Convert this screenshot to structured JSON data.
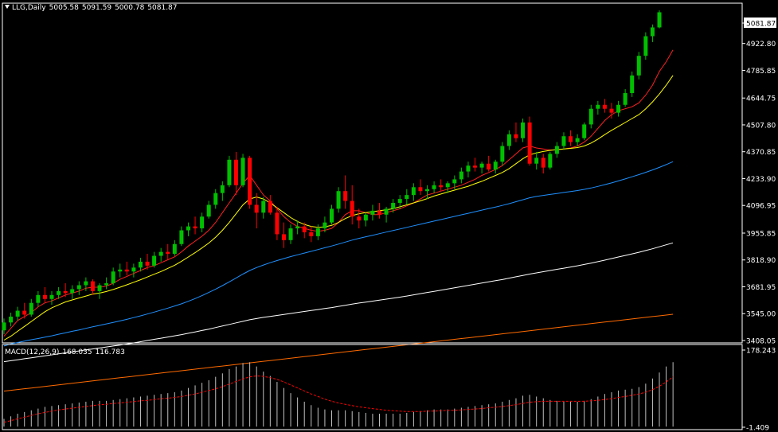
{
  "header": {
    "symbol": "LLG,Daily",
    "open": "5005.58",
    "high": "5091.59",
    "low": "5000.78",
    "close": "5081.87"
  },
  "macd_header": {
    "name": "MACD(12,26,9)",
    "macd": "168.035",
    "signal": "116.783"
  },
  "colors": {
    "background": "#000000",
    "frame": "#ffffff",
    "bull": "#00c000",
    "bear": "#ff0000",
    "ma_red": "#ff2020",
    "ma_yellow": "#ffff00",
    "ma_blue": "#1e90ff",
    "ma_white": "#ffffff",
    "ma_orange": "#ff6a00",
    "signal": "#ff0000"
  },
  "chart_data": {
    "type": "candlestick",
    "ylim": [
      3408.05,
      5096.0
    ],
    "y_ticks": [
      "5081.87",
      "4922.80",
      "4785.85",
      "4644.75",
      "4507.80",
      "4370.85",
      "4233.90",
      "4096.95",
      "3955.85",
      "3818.90",
      "3681.95",
      "3545.00",
      "3408.05"
    ],
    "current_price_label": "5081.87",
    "candles": [
      [
        3460,
        3520,
        3440,
        3500
      ],
      [
        3500,
        3550,
        3480,
        3530
      ],
      [
        3530,
        3580,
        3510,
        3560
      ],
      [
        3560,
        3600,
        3520,
        3540
      ],
      [
        3540,
        3620,
        3530,
        3600
      ],
      [
        3600,
        3660,
        3580,
        3640
      ],
      [
        3640,
        3680,
        3600,
        3620
      ],
      [
        3620,
        3660,
        3590,
        3640
      ],
      [
        3640,
        3680,
        3620,
        3660
      ],
      [
        3660,
        3700,
        3630,
        3650
      ],
      [
        3650,
        3690,
        3620,
        3670
      ],
      [
        3670,
        3710,
        3640,
        3690
      ],
      [
        3690,
        3730,
        3660,
        3710
      ],
      [
        3710,
        3720,
        3640,
        3660
      ],
      [
        3660,
        3700,
        3620,
        3690
      ],
      [
        3690,
        3730,
        3670,
        3700
      ],
      [
        3700,
        3780,
        3690,
        3760
      ],
      [
        3760,
        3800,
        3730,
        3770
      ],
      [
        3770,
        3810,
        3740,
        3760
      ],
      [
        3760,
        3800,
        3730,
        3780
      ],
      [
        3780,
        3830,
        3760,
        3810
      ],
      [
        3810,
        3850,
        3770,
        3790
      ],
      [
        3790,
        3860,
        3780,
        3840
      ],
      [
        3840,
        3880,
        3810,
        3860
      ],
      [
        3860,
        3900,
        3820,
        3850
      ],
      [
        3850,
        3920,
        3840,
        3900
      ],
      [
        3900,
        3990,
        3890,
        3970
      ],
      [
        3970,
        4010,
        3940,
        3990
      ],
      [
        3990,
        4040,
        3950,
        3980
      ],
      [
        3980,
        4060,
        3960,
        4040
      ],
      [
        4040,
        4120,
        4030,
        4100
      ],
      [
        4100,
        4180,
        4080,
        4160
      ],
      [
        4160,
        4220,
        4120,
        4200
      ],
      [
        4200,
        4350,
        4190,
        4330
      ],
      [
        4330,
        4370,
        4150,
        4200
      ],
      [
        4200,
        4360,
        4190,
        4340
      ],
      [
        4340,
        4350,
        4080,
        4100
      ],
      [
        4100,
        4160,
        3980,
        4060
      ],
      [
        4060,
        4140,
        4030,
        4120
      ],
      [
        4120,
        4150,
        4050,
        4060
      ],
      [
        4060,
        4090,
        3920,
        3950
      ],
      [
        3950,
        4010,
        3880,
        3920
      ],
      [
        3920,
        4000,
        3900,
        3980
      ],
      [
        3980,
        4020,
        3950,
        3990
      ],
      [
        3990,
        4010,
        3930,
        3960
      ],
      [
        3960,
        3990,
        3910,
        3940
      ],
      [
        3940,
        4000,
        3920,
        3980
      ],
      [
        3980,
        4040,
        3960,
        4010
      ],
      [
        4010,
        4100,
        4000,
        4080
      ],
      [
        4080,
        4190,
        4060,
        4170
      ],
      [
        4170,
        4250,
        4080,
        4120
      ],
      [
        4120,
        4200,
        4000,
        4040
      ],
      [
        4040,
        4080,
        3980,
        4020
      ],
      [
        4020,
        4060,
        3990,
        4050
      ],
      [
        4050,
        4100,
        4020,
        4070
      ],
      [
        4070,
        4110,
        4030,
        4050
      ],
      [
        4050,
        4090,
        4010,
        4080
      ],
      [
        4080,
        4130,
        4060,
        4110
      ],
      [
        4110,
        4150,
        4080,
        4130
      ],
      [
        4130,
        4180,
        4100,
        4150
      ],
      [
        4150,
        4210,
        4120,
        4190
      ],
      [
        4190,
        4230,
        4150,
        4170
      ],
      [
        4170,
        4200,
        4130,
        4180
      ],
      [
        4180,
        4220,
        4160,
        4200
      ],
      [
        4200,
        4230,
        4170,
        4190
      ],
      [
        4190,
        4220,
        4160,
        4210
      ],
      [
        4210,
        4250,
        4180,
        4230
      ],
      [
        4230,
        4290,
        4210,
        4270
      ],
      [
        4270,
        4320,
        4240,
        4300
      ],
      [
        4300,
        4340,
        4270,
        4290
      ],
      [
        4290,
        4320,
        4260,
        4310
      ],
      [
        4310,
        4350,
        4270,
        4280
      ],
      [
        4280,
        4330,
        4260,
        4320
      ],
      [
        4320,
        4420,
        4300,
        4400
      ],
      [
        4400,
        4480,
        4380,
        4460
      ],
      [
        4460,
        4520,
        4420,
        4440
      ],
      [
        4440,
        4540,
        4420,
        4520
      ],
      [
        4520,
        4550,
        4300,
        4310
      ],
      [
        4310,
        4370,
        4280,
        4340
      ],
      [
        4340,
        4360,
        4260,
        4290
      ],
      [
        4290,
        4370,
        4280,
        4360
      ],
      [
        4360,
        4420,
        4340,
        4400
      ],
      [
        4400,
        4470,
        4380,
        4450
      ],
      [
        4450,
        4480,
        4400,
        4420
      ],
      [
        4420,
        4460,
        4400,
        4440
      ],
      [
        4440,
        4520,
        4430,
        4510
      ],
      [
        4510,
        4610,
        4490,
        4590
      ],
      [
        4590,
        4630,
        4560,
        4610
      ],
      [
        4610,
        4640,
        4570,
        4590
      ],
      [
        4590,
        4620,
        4540,
        4570
      ],
      [
        4570,
        4630,
        4550,
        4610
      ],
      [
        4610,
        4690,
        4600,
        4670
      ],
      [
        4670,
        4780,
        4650,
        4760
      ],
      [
        4760,
        4880,
        4740,
        4860
      ],
      [
        4860,
        4980,
        4840,
        4960
      ],
      [
        4960,
        5020,
        4930,
        5005
      ],
      [
        5005,
        5092,
        5000,
        5082
      ]
    ],
    "moving_averages": [
      {
        "color": "ma_red",
        "values": [
          3430,
          3470,
          3510,
          3530,
          3550,
          3580,
          3600,
          3610,
          3625,
          3640,
          3650,
          3660,
          3675,
          3680,
          3680,
          3685,
          3700,
          3720,
          3735,
          3750,
          3765,
          3780,
          3790,
          3805,
          3820,
          3835,
          3860,
          3890,
          3915,
          3940,
          3970,
          4010,
          4060,
          4110,
          4160,
          4210,
          4250,
          4200,
          4150,
          4120,
          4080,
          4040,
          4010,
          3990,
          3980,
          3970,
          3965,
          3970,
          3980,
          4010,
          4050,
          4070,
          4070,
          4060,
          4050,
          4050,
          4060,
          4070,
          4080,
          4095,
          4110,
          4130,
          4150,
          4160,
          4170,
          4180,
          4190,
          4200,
          4215,
          4230,
          4250,
          4265,
          4280,
          4300,
          4330,
          4360,
          4390,
          4400,
          4390,
          4385,
          4380,
          4380,
          4385,
          4390,
          4400,
          4420,
          4450,
          4490,
          4530,
          4560,
          4580,
          4590,
          4600,
          4620,
          4660,
          4710,
          4780,
          4830,
          4890
        ]
      },
      {
        "color": "ma_yellow",
        "values": [
          3410,
          3430,
          3455,
          3480,
          3505,
          3530,
          3555,
          3575,
          3590,
          3605,
          3615,
          3625,
          3635,
          3645,
          3650,
          3658,
          3668,
          3680,
          3692,
          3705,
          3718,
          3732,
          3746,
          3760,
          3776,
          3792,
          3812,
          3834,
          3856,
          3880,
          3905,
          3935,
          3970,
          4010,
          4055,
          4100,
          4130,
          4140,
          4130,
          4110,
          4085,
          4060,
          4035,
          4015,
          4000,
          3990,
          3985,
          3988,
          3995,
          4010,
          4030,
          4045,
          4055,
          4060,
          4065,
          4070,
          4075,
          4080,
          4090,
          4100,
          4110,
          4120,
          4132,
          4145,
          4155,
          4165,
          4175,
          4185,
          4195,
          4208,
          4220,
          4235,
          4250,
          4265,
          4285,
          4310,
          4335,
          4355,
          4365,
          4372,
          4378,
          4382,
          4385,
          4388,
          4392,
          4400,
          4415,
          4435,
          4458,
          4480,
          4500,
          4520,
          4540,
          4560,
          4590,
          4625,
          4665,
          4710,
          4760
        ]
      },
      {
        "color": "ma_blue",
        "values": [
          3380,
          3390,
          3398,
          3405,
          3412,
          3418,
          3425,
          3432,
          3440,
          3447,
          3455,
          3462,
          3470,
          3478,
          3485,
          3493,
          3500,
          3508,
          3516,
          3525,
          3534,
          3543,
          3553,
          3563,
          3573,
          3584,
          3595,
          3608,
          3622,
          3637,
          3653,
          3670,
          3688,
          3707,
          3727,
          3747,
          3765,
          3780,
          3793,
          3805,
          3816,
          3826,
          3836,
          3845,
          3854,
          3863,
          3872,
          3881,
          3890,
          3900,
          3910,
          3920,
          3929,
          3937,
          3945,
          3953,
          3961,
          3969,
          3977,
          3985,
          3993,
          4001,
          4009,
          4017,
          4025,
          4033,
          4041,
          4049,
          4057,
          4065,
          4073,
          4081,
          4089,
          4097,
          4106,
          4116,
          4126,
          4136,
          4143,
          4148,
          4153,
          4158,
          4163,
          4168,
          4173,
          4179,
          4186,
          4194,
          4203,
          4212,
          4222,
          4232,
          4243,
          4254,
          4266,
          4278,
          4291,
          4305,
          4320
        ]
      },
      {
        "color": "ma_white",
        "values": [
          3300,
          3305,
          3310,
          3315,
          3320,
          3325,
          3330,
          3335,
          3340,
          3345,
          3350,
          3355,
          3360,
          3365,
          3370,
          3375,
          3380,
          3385,
          3390,
          3396,
          3402,
          3408,
          3414,
          3420,
          3426,
          3432,
          3438,
          3445,
          3452,
          3459,
          3466,
          3474,
          3482,
          3490,
          3498,
          3506,
          3514,
          3520,
          3526,
          3531,
          3536,
          3541,
          3546,
          3551,
          3556,
          3561,
          3566,
          3571,
          3576,
          3582,
          3588,
          3594,
          3599,
          3604,
          3609,
          3614,
          3619,
          3624,
          3629,
          3635,
          3641,
          3647,
          3653,
          3659,
          3665,
          3671,
          3677,
          3683,
          3689,
          3695,
          3701,
          3707,
          3713,
          3719,
          3726,
          3733,
          3740,
          3747,
          3753,
          3759,
          3765,
          3771,
          3777,
          3783,
          3789,
          3796,
          3803,
          3810,
          3818,
          3826,
          3834,
          3842,
          3850,
          3858,
          3867,
          3876,
          3886,
          3896,
          3906
        ]
      },
      {
        "color": "ma_orange",
        "values": [
          3150,
          3154,
          3158,
          3162,
          3166,
          3170,
          3174,
          3178,
          3182,
          3186,
          3190,
          3194,
          3198,
          3202,
          3206,
          3210,
          3214,
          3218,
          3222,
          3226,
          3230,
          3234,
          3238,
          3242,
          3246,
          3250,
          3254,
          3258,
          3262,
          3266,
          3270,
          3274,
          3278,
          3282,
          3286,
          3290,
          3294,
          3298,
          3302,
          3306,
          3310,
          3314,
          3318,
          3322,
          3326,
          3330,
          3334,
          3338,
          3342,
          3346,
          3350,
          3354,
          3358,
          3362,
          3366,
          3370,
          3374,
          3378,
          3382,
          3386,
          3390,
          3394,
          3398,
          3402,
          3406,
          3410,
          3414,
          3418,
          3422,
          3426,
          3430,
          3434,
          3438,
          3442,
          3446,
          3450,
          3454,
          3458,
          3462,
          3466,
          3470,
          3474,
          3478,
          3482,
          3486,
          3490,
          3494,
          3498,
          3502,
          3506,
          3510,
          3514,
          3518,
          3522,
          3526,
          3530,
          3534,
          3538,
          3542
        ]
      }
    ],
    "macd": {
      "ylim": [
        -1.409,
        178.243
      ],
      "y_ticks": [
        "178.243",
        "-1.409"
      ],
      "values": [
        18,
        24,
        30,
        34,
        38,
        42,
        46,
        48,
        50,
        52,
        54,
        56,
        58,
        60,
        60,
        60,
        62,
        64,
        66,
        68,
        70,
        72,
        74,
        76,
        78,
        80,
        84,
        90,
        96,
        102,
        108,
        116,
        124,
        134,
        140,
        148,
        150,
        140,
        128,
        118,
        104,
        90,
        78,
        68,
        58,
        50,
        44,
        40,
        38,
        38,
        38,
        36,
        34,
        32,
        30,
        30,
        30,
        30,
        30,
        32,
        34,
        36,
        38,
        40,
        40,
        40,
        42,
        44,
        46,
        48,
        50,
        52,
        54,
        58,
        62,
        66,
        72,
        74,
        70,
        66,
        62,
        60,
        58,
        58,
        58,
        60,
        64,
        70,
        76,
        80,
        84,
        86,
        88,
        92,
        100,
        112,
        126,
        140,
        150
      ],
      "signal": [
        10,
        14,
        18,
        22,
        26,
        30,
        33,
        36,
        39,
        41,
        43,
        45,
        47,
        49,
        51,
        52,
        54,
        55,
        57,
        58,
        60,
        61,
        63,
        65,
        66,
        68,
        70,
        73,
        76,
        80,
        84,
        88,
        93,
        99,
        105,
        111,
        116,
        118,
        117,
        114,
        110,
        104,
        97,
        90,
        83,
        76,
        70,
        64,
        59,
        55,
        52,
        49,
        46,
        44,
        42,
        40,
        38,
        37,
        36,
        35,
        35,
        35,
        36,
        36,
        37,
        38,
        38,
        39,
        40,
        41,
        42,
        44,
        45,
        47,
        49,
        51,
        54,
        57,
        58,
        59,
        59,
        59,
        59,
        59,
        59,
        59,
        60,
        61,
        63,
        65,
        68,
        70,
        73,
        76,
        80,
        86,
        94,
        104,
        116
      ]
    }
  }
}
